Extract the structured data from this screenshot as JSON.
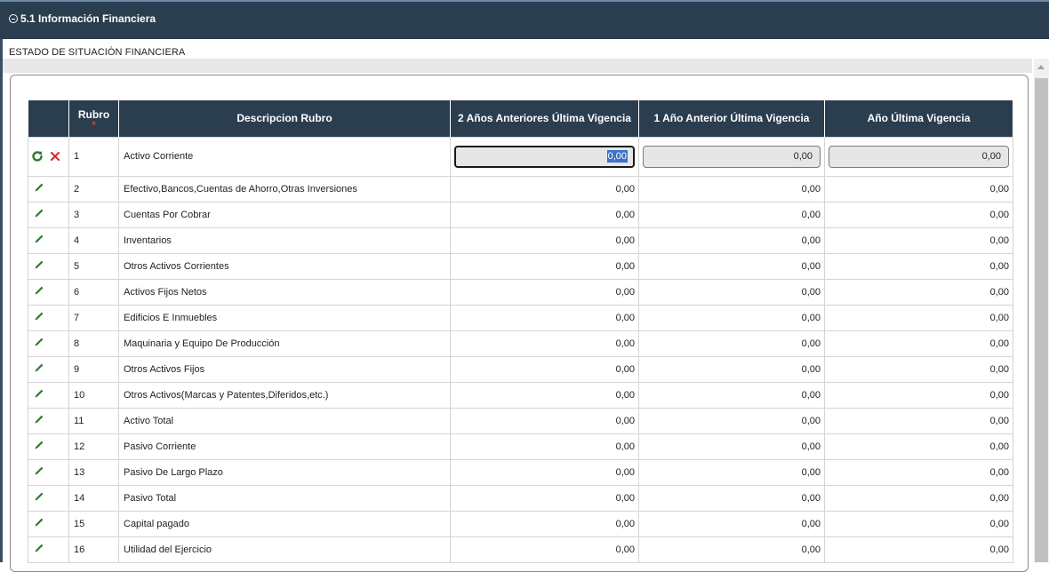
{
  "section": {
    "title": "5.1 Información Financiera"
  },
  "subtitle": "ESTADO DE SITUACIÓN FINANCIERA",
  "colors": {
    "header_bg": "#2b3e50",
    "edit_icon": "#2e7d32",
    "cancel_icon": "#d32f2f",
    "selection": "#3b73c8"
  },
  "table": {
    "headers": {
      "actions": "",
      "rubro": "Rubro",
      "rubro_required": "*",
      "descripcion": "Descripcion Rubro",
      "col1": "2 Años Anteriores Última Vigencia",
      "col2": "1 Año Anterior Última Vigencia",
      "col3": "Año Última Vigencia"
    },
    "edit_row": {
      "rubro": "1",
      "descripcion": "Activo Corriente",
      "col1": "0,00",
      "col2": "0,00",
      "col3": "0,00",
      "actions": [
        "refresh-icon",
        "cancel-icon"
      ]
    },
    "rows": [
      {
        "rubro": "2",
        "descripcion": "Efectivo,Bancos,Cuentas de Ahorro,Otras Inversiones",
        "col1": "0,00",
        "col2": "0,00",
        "col3": "0,00"
      },
      {
        "rubro": "3",
        "descripcion": "Cuentas Por Cobrar",
        "col1": "0,00",
        "col2": "0,00",
        "col3": "0,00"
      },
      {
        "rubro": "4",
        "descripcion": "Inventarios",
        "col1": "0,00",
        "col2": "0,00",
        "col3": "0,00"
      },
      {
        "rubro": "5",
        "descripcion": "Otros Activos Corrientes",
        "col1": "0,00",
        "col2": "0,00",
        "col3": "0,00"
      },
      {
        "rubro": "6",
        "descripcion": "Activos Fijos Netos",
        "col1": "0,00",
        "col2": "0,00",
        "col3": "0,00"
      },
      {
        "rubro": "7",
        "descripcion": "Edificios E Inmuebles",
        "col1": "0,00",
        "col2": "0,00",
        "col3": "0,00"
      },
      {
        "rubro": "8",
        "descripcion": "Maquinaria y Equipo De Producción",
        "col1": "0,00",
        "col2": "0,00",
        "col3": "0,00"
      },
      {
        "rubro": "9",
        "descripcion": "Otros Activos Fijos",
        "col1": "0,00",
        "col2": "0,00",
        "col3": "0,00"
      },
      {
        "rubro": "10",
        "descripcion": "Otros Activos(Marcas y Patentes,Diferidos,etc.)",
        "col1": "0,00",
        "col2": "0,00",
        "col3": "0,00"
      },
      {
        "rubro": "11",
        "descripcion": "Activo Total",
        "col1": "0,00",
        "col2": "0,00",
        "col3": "0,00"
      },
      {
        "rubro": "12",
        "descripcion": "Pasivo Corriente",
        "col1": "0,00",
        "col2": "0,00",
        "col3": "0,00"
      },
      {
        "rubro": "13",
        "descripcion": "Pasivo De Largo Plazo",
        "col1": "0,00",
        "col2": "0,00",
        "col3": "0,00"
      },
      {
        "rubro": "14",
        "descripcion": "Pasivo Total",
        "col1": "0,00",
        "col2": "0,00",
        "col3": "0,00"
      },
      {
        "rubro": "15",
        "descripcion": "Capital pagado",
        "col1": "0,00",
        "col2": "0,00",
        "col3": "0,00"
      },
      {
        "rubro": "16",
        "descripcion": "Utilidad del Ejercicio",
        "col1": "0,00",
        "col2": "0,00",
        "col3": "0,00"
      }
    ]
  }
}
